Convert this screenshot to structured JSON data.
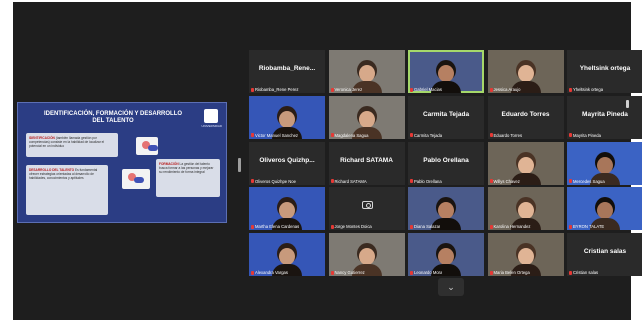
{
  "shared_content": {
    "title": "IDENTIFICACIÓN, FORMACIÓN Y DESARROLLO DEL TALENTO",
    "logo_text": "UNIVERSIDAD",
    "boxes": [
      {
        "heading": "IDENTIFICACIÓN",
        "text": "(también llamada gestión por competencias) consiste en la habilidad de localizar el potencial en un individuo"
      },
      {
        "heading": "FORMACIÓN",
        "text": "La gestión del talento busca formar a las personas y mejorar su rendimiento de forma integral"
      },
      {
        "heading": "DESARROLLO DEL TALENTO",
        "text": "Es fundamental ofrecer estrategias orientadas al desarrollo de habilidades, conocimientos y aptitudes"
      }
    ]
  },
  "gallery": [
    {
      "label": "Riobamba_Rene Perez",
      "big_name": "Riobamba_Rene...",
      "video": false
    },
    {
      "label": "Veronica Jerez",
      "big_name": "",
      "video": true
    },
    {
      "label": "Gabriel Macias",
      "big_name": "",
      "video": true,
      "active": true
    },
    {
      "label": "Jessica Araujo",
      "big_name": "",
      "video": true
    },
    {
      "label": "Yheltsink ortega",
      "big_name": "Yheltsink ortega",
      "video": false
    },
    {
      "label": "Victor Manuel Sanchez",
      "big_name": "",
      "video": true
    },
    {
      "label": "Magdalena Sagua",
      "big_name": "",
      "video": true
    },
    {
      "label": "Carmita Tejada",
      "big_name": "Carmita Tejada",
      "video": false
    },
    {
      "label": "Eduardo Torres",
      "big_name": "Eduardo Torres",
      "video": false
    },
    {
      "label": "Mayrita Pineda",
      "big_name": "Mayrita Pineda",
      "video": false
    },
    {
      "label": "Oliveros Quizhpe Noe",
      "big_name": "Oliveros Quizhp...",
      "video": false
    },
    {
      "label": "Richard SATAMA",
      "big_name": "Richard SATAMA",
      "video": false
    },
    {
      "label": "Pablo Orellana",
      "big_name": "Pablo Orellana",
      "video": false
    },
    {
      "label": "Willys Chavez",
      "big_name": "",
      "video": true
    },
    {
      "label": "Mercedes Sagua",
      "big_name": "",
      "video": true
    },
    {
      "label": "Martha Elena Cardenas",
      "big_name": "",
      "video": true
    },
    {
      "label": "Jorge Montes Doica",
      "big_name": "",
      "video": false,
      "camera_icon": true
    },
    {
      "label": "Diana Salazar",
      "big_name": "",
      "video": true
    },
    {
      "label": "Karolina Hernandez",
      "big_name": "",
      "video": true
    },
    {
      "label": "BYRON TALATE",
      "big_name": "",
      "video": true
    },
    {
      "label": "Alexandra Vargas",
      "big_name": "",
      "video": true
    },
    {
      "label": "Nancy Gutierrez",
      "big_name": "",
      "video": true
    },
    {
      "label": "Leonardo Mora",
      "big_name": "",
      "video": true
    },
    {
      "label": "Maria Belen Ortega",
      "big_name": "",
      "video": true
    },
    {
      "label": "Cristian salas",
      "big_name": "Cristian salas",
      "video": false
    }
  ],
  "controls": {
    "next_page_glyph": "⌄"
  },
  "colors": {
    "tile_dark": "#2a2a2a",
    "tile_blue": "#3556b7",
    "active_speaker": "#a5d86a",
    "muted_mic": "#e53935"
  }
}
